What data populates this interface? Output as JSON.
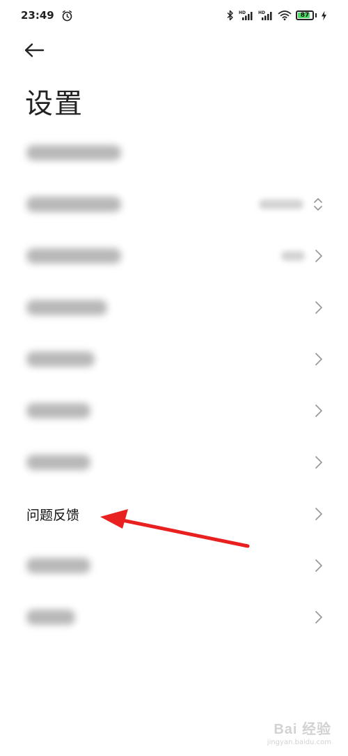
{
  "status_bar": {
    "time": "23:49",
    "battery_level": "87",
    "battery_color": "#4cd964",
    "icons": [
      "alarm-icon",
      "bluetooth-icon",
      "signal-hd-icon",
      "signal-hd-icon",
      "wifi-icon",
      "battery-icon",
      "charging-icon"
    ]
  },
  "header": {
    "back_icon": "back-arrow-icon",
    "title": "设置"
  },
  "settings": {
    "items": [
      {
        "label": "",
        "blurred": true,
        "right": "none"
      },
      {
        "label": "",
        "blurred": true,
        "right": "updown",
        "has_value": true
      },
      {
        "label": "",
        "blurred": true,
        "right": "chevron",
        "has_value": true
      },
      {
        "label": "",
        "blurred": true,
        "right": "chevron"
      },
      {
        "label": "",
        "blurred": true,
        "right": "chevron"
      },
      {
        "label": "",
        "blurred": true,
        "right": "chevron"
      },
      {
        "label": "",
        "blurred": true,
        "right": "chevron"
      },
      {
        "label": "问题反馈",
        "blurred": false,
        "right": "chevron"
      },
      {
        "label": "",
        "blurred": true,
        "right": "chevron"
      },
      {
        "label": "",
        "blurred": true,
        "right": "chevron"
      }
    ]
  },
  "annotation": {
    "type": "red-arrow",
    "color": "#e8201f",
    "target": "问题反馈"
  },
  "watermark": {
    "text": "Bai 经验",
    "sub": "jingyan.baidu.com"
  }
}
